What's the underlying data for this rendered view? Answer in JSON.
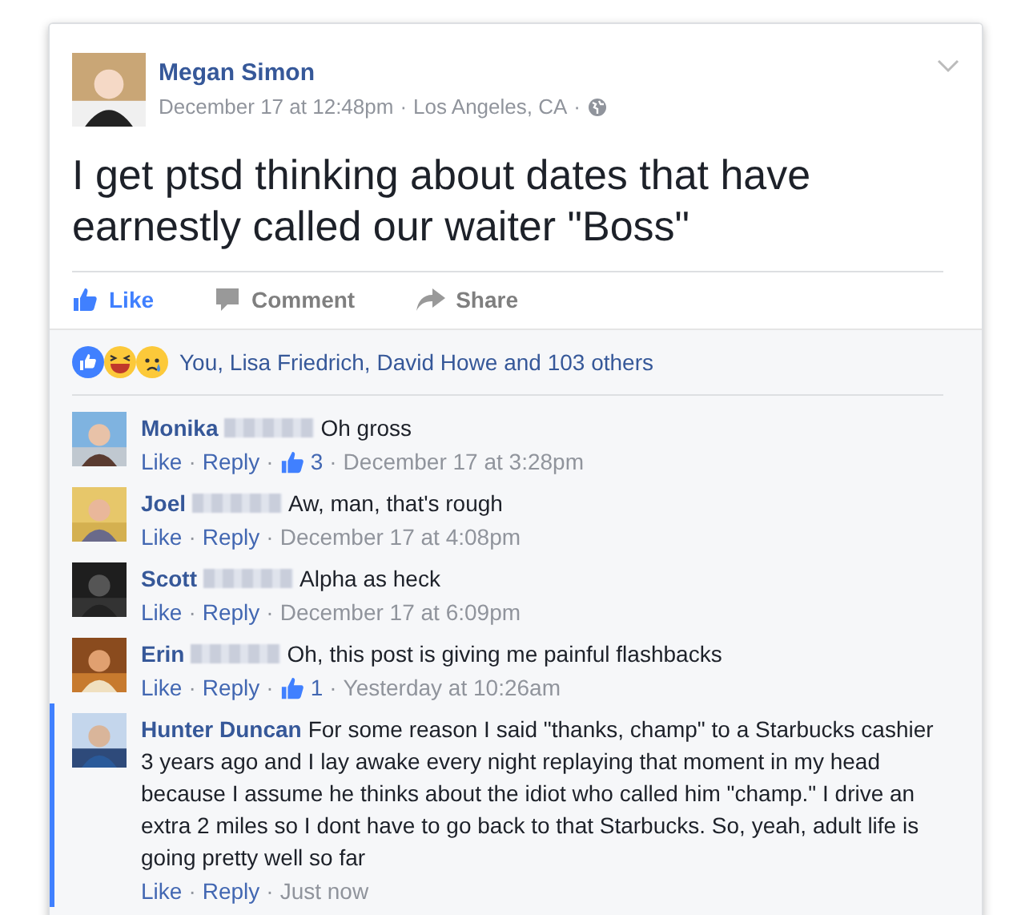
{
  "post": {
    "author": "Megan Simon",
    "time": "December 17 at 12:48pm",
    "separator": "·",
    "location": "Los Angeles, CA",
    "separator_2": "·",
    "text": "I get ptsd thinking about dates that have earnestly called our waiter \"Boss\""
  },
  "actions": [
    {
      "kind": "like",
      "label": "Like",
      "selected": true
    },
    {
      "kind": "comment",
      "label": "Comment",
      "selected": false
    },
    {
      "kind": "share",
      "label": "Share",
      "selected": false
    }
  ],
  "reactions": {
    "summary": "You, Lisa Friedrich, David Howe and 103 others"
  },
  "comments": [
    {
      "name": "Monika",
      "surname_hidden": true,
      "text": "Oh gross",
      "like": "Like",
      "reply": "Reply",
      "separator": "·",
      "likes": "3",
      "time": "December 17 at 3:28pm",
      "highlighted": false
    },
    {
      "name": "Joel",
      "surname_hidden": true,
      "text": "Aw, man, that's rough",
      "like": "Like",
      "reply": "Reply",
      "separator": "·",
      "time": "December 17 at 4:08pm",
      "highlighted": false
    },
    {
      "name": "Scott",
      "surname_hidden": true,
      "text": "Alpha as heck",
      "like": "Like",
      "reply": "Reply",
      "separator": "·",
      "time": "December 17 at 6:09pm",
      "highlighted": false
    },
    {
      "name": "Erin",
      "surname_hidden": true,
      "text": "Oh, this post is giving me painful flashbacks",
      "like": "Like",
      "reply": "Reply",
      "separator": "·",
      "likes": "1",
      "time": "Yesterday at 10:26am",
      "highlighted": false
    },
    {
      "name": "Hunter Duncan",
      "surname_hidden": false,
      "text": "For some reason I said \"thanks, champ\" to a Starbucks cashier 3 years ago and I lay awake every night replaying that moment in my head because I assume he thinks about the idiot who called him \"champ.\" I drive an extra 2 miles so I dont have to go back to that Starbucks. So, yeah, adult life is going pretty well so far",
      "like": "Like",
      "reply": "Reply",
      "separator": "·",
      "time": "Just now",
      "highlighted": true
    }
  ]
}
